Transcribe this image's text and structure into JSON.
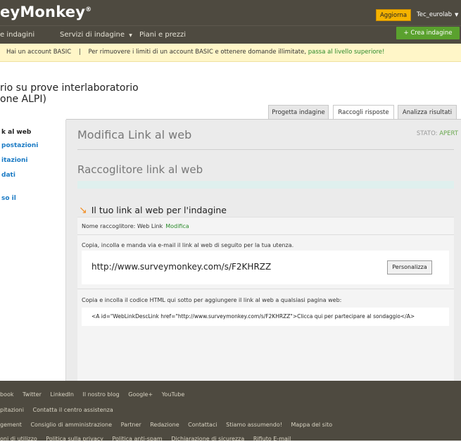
{
  "topbar": {
    "logo": "eyMonkey",
    "logo_mark": "®",
    "upgrade_button": "Aggiorna",
    "user": "Tec_eurolab",
    "user_caret": "▼"
  },
  "nav": {
    "items": [
      {
        "label": "e indagini"
      },
      {
        "label": "Servizi di indagine",
        "caret": "▼"
      },
      {
        "label": "Piani e prezzi"
      }
    ],
    "create_button": "+ Crea indagine"
  },
  "banner": {
    "account_text": "Hai un account BASIC",
    "separator": "|",
    "message": "Per rimuovere i limiti di un account BASIC e ottenere domande illimitate,",
    "upgrade_link": "passa al livello superiore!"
  },
  "survey": {
    "title_line1": "rio su prove interlaboratorio",
    "title_line2": "one ALPI)"
  },
  "tabs": [
    {
      "label": "Progetta indagine",
      "active": false
    },
    {
      "label": "Raccogli risposte",
      "active": true
    },
    {
      "label": "Analizza risultati",
      "active": false
    }
  ],
  "sidebar": {
    "items": [
      {
        "label": "k al web",
        "color": "#222222"
      },
      {
        "label": "postazioni",
        "color": "#1a7ac4"
      },
      {
        "label": "itazioni",
        "color": "#1a7ac4"
      },
      {
        "label": "dati",
        "color": "#1a7ac4"
      },
      {
        "label": "so il",
        "color": "#1a7ac4"
      }
    ]
  },
  "main": {
    "title": "Modifica Link al web",
    "status_label": "STATO:",
    "status_value": "APERT",
    "section_title": "Raccoglitore link al web",
    "link_heading": "Il tuo link al web per l'indagine",
    "collector_name_label": "Nome raccoglitore: Web Link",
    "modify_link": "Modifica",
    "instructions_email": "Copia, incolla e manda via e-mail il link al web di seguito per la tua utenza.",
    "url": "http://www.surveymonkey.com/s/F2KHRZZ",
    "customize_button": "Personalizza",
    "instructions_html": "Copia e incolla il codice HTML qui sotto per aggiungere il link al web a qualsiasi pagina web:",
    "html_code": "<A id=\"WebLinkDescLink href=\"http://www.surveymonkey.com/s/F2KHRZZ\">Clicca qui per partecipare al sondaggio</A>"
  },
  "footer": {
    "row1": [
      "book",
      "Twitter",
      "LinkedIn",
      "Il nostro blog",
      "Google+",
      "YouTube"
    ],
    "row2": [
      "pitazioni",
      "Contatta il centro assistenza"
    ],
    "row3": [
      "gement",
      "Consiglio di amministrazione",
      "Partner",
      "Redazione",
      "Contattaci",
      "Stiamo assumendo!",
      "Mappa del sito"
    ],
    "row4": [
      "oni di utilizzo",
      "Politica sulla privacy",
      "Politica anti-spam",
      "Dichiarazione di sicurezza",
      "Rifiuto E-mail"
    ]
  }
}
